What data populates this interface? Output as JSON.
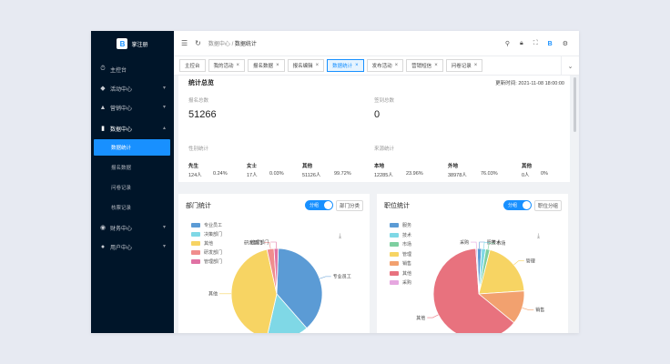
{
  "app": {
    "name": "掌注册",
    "logo_letter": "B"
  },
  "sidebar": {
    "items": [
      {
        "label": "主控台",
        "icon": "clock-icon",
        "glyph": "⏱"
      },
      {
        "label": "活动中心",
        "icon": "diamond-icon",
        "glyph": "◆",
        "chevron": "▾"
      },
      {
        "label": "营销中心",
        "icon": "warning-icon",
        "glyph": "▲",
        "chevron": "▾"
      },
      {
        "label": "数据中心",
        "icon": "chart-icon",
        "glyph": "▮",
        "chevron": "▴"
      },
      {
        "label": "财务中心",
        "icon": "money-icon",
        "glyph": "◉",
        "chevron": "▾"
      },
      {
        "label": "用户中心",
        "icon": "user-icon",
        "glyph": "●",
        "chevron": "▾"
      }
    ],
    "subitems": [
      {
        "label": "数据统计",
        "active": true
      },
      {
        "label": "报名数据",
        "active": false
      },
      {
        "label": "问卷记录",
        "active": false
      },
      {
        "label": "核票记录",
        "active": false
      }
    ]
  },
  "topbar": {
    "breadcrumb_parent": "数据中心",
    "breadcrumb_sep": "/",
    "breadcrumb_current": "数据统计"
  },
  "tabs": [
    {
      "label": "主控台",
      "closable": false,
      "active": false
    },
    {
      "label": "我的活动",
      "closable": true,
      "active": false
    },
    {
      "label": "报名数据",
      "closable": true,
      "active": false
    },
    {
      "label": "报名编辑",
      "closable": true,
      "active": false
    },
    {
      "label": "数据统计",
      "closable": true,
      "active": true
    },
    {
      "label": "发布活动",
      "closable": true,
      "active": false
    },
    {
      "label": "营销短信",
      "closable": true,
      "active": false
    },
    {
      "label": "问卷记录",
      "closable": true,
      "active": false
    }
  ],
  "stats": {
    "title": "统计总览",
    "updated": "更新时间: 2021-11-08 18:00:00",
    "signup_label": "报名总数",
    "signup_value": "51266",
    "checkin_label": "签到总数",
    "checkin_value": "0",
    "gender_label": "性别统计",
    "gender": [
      {
        "name": "先生",
        "count": "124人",
        "pct": "0.24%"
      },
      {
        "name": "女士",
        "count": "17人",
        "pct": "0.03%"
      },
      {
        "name": "其他",
        "count": "51126人",
        "pct": "99.72%"
      }
    ],
    "source_label": "来源统计",
    "source": [
      {
        "name": "本地",
        "count": "12285人",
        "pct": "23.96%"
      },
      {
        "name": "外地",
        "count": "38978人",
        "pct": "76.03%"
      },
      {
        "name": "其他",
        "count": "0人",
        "pct": "0%"
      }
    ]
  },
  "dept_card": {
    "title": "部门统计",
    "switch_on": "分组",
    "switch_off": "部门分类",
    "download_glyph": "⤓",
    "legend": [
      {
        "label": "专业员工",
        "color": "#5b9bd5"
      },
      {
        "label": "决策部门",
        "color": "#7fd8e6"
      },
      {
        "label": "其他",
        "color": "#f7d463"
      },
      {
        "label": "研发部门",
        "color": "#f08d8d"
      },
      {
        "label": "管理部门",
        "color": "#e072a4"
      }
    ],
    "chart_data": {
      "type": "pie",
      "slices": [
        {
          "label": "专业员工",
          "value": 38,
          "color": "#5b9bd5"
        },
        {
          "label": "决策部门",
          "value": 15,
          "color": "#7fd8e6"
        },
        {
          "label": "其他",
          "value": 43,
          "color": "#f7d463"
        },
        {
          "label": "研发部门",
          "value": 2.5,
          "color": "#f08d8d"
        },
        {
          "label": "管理部门",
          "value": 1.5,
          "color": "#e072a4"
        }
      ]
    }
  },
  "pos_card": {
    "title": "职位统计",
    "switch_on": "分组",
    "switch_off": "职位分组",
    "download_glyph": "⤓",
    "legend": [
      {
        "label": "服务",
        "color": "#5b9bd5"
      },
      {
        "label": "技术",
        "color": "#7fd8e6"
      },
      {
        "label": "市场",
        "color": "#7ecfa0"
      },
      {
        "label": "管理",
        "color": "#f7d463"
      },
      {
        "label": "销售",
        "color": "#f2a16f"
      },
      {
        "label": "其他",
        "color": "#e8727e"
      },
      {
        "label": "采购",
        "color": "#e6a7e0"
      }
    ],
    "chart_data": {
      "type": "pie",
      "slices": [
        {
          "label": "服务",
          "value": 1.5,
          "color": "#5b9bd5"
        },
        {
          "label": "技术",
          "value": 1.5,
          "color": "#7fd8e6"
        },
        {
          "label": "市场",
          "value": 1.5,
          "color": "#7ecfa0"
        },
        {
          "label": "管理",
          "value": 20,
          "color": "#f7d463"
        },
        {
          "label": "销售",
          "value": 12,
          "color": "#f2a16f"
        },
        {
          "label": "其他",
          "value": 63,
          "color": "#e8727e"
        },
        {
          "label": "采购",
          "value": 0.5,
          "color": "#e6a7e0"
        }
      ]
    }
  }
}
